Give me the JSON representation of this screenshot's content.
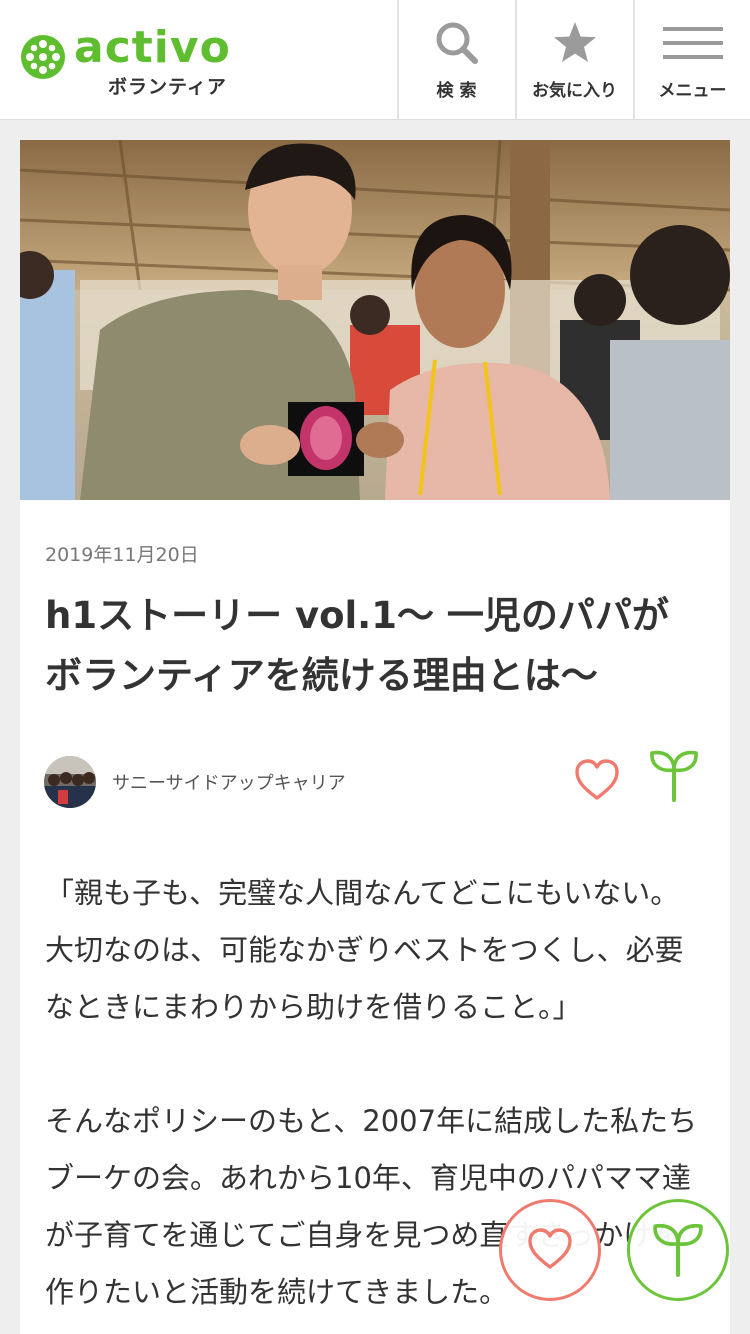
{
  "header": {
    "logo_text": "activo",
    "logo_subtitle": "ボランティア",
    "nav": {
      "search_label": "検 索",
      "favorites_label": "お気に入り",
      "menu_label": "メニュー"
    }
  },
  "article": {
    "date": "2019年11月20日",
    "title": "h1ストーリー vol.1〜 一児のパパがボランティアを続ける理由とは〜",
    "author": "サニーサイドアップキャリア",
    "paragraphs": [
      "「親も子も、完璧な人間なんてどこにもいない。大切なのは、可能なかぎりベストをつくし、必要なときにまわりから助けを借りること。」",
      "そんなポリシーのもと、2007年に結成した私たちブーケの会。あれから10年、育児中のパパママ達が子育てを通じてご自身を見つめ直すきっかけを作りたいと活動を続けてきました。"
    ]
  },
  "icons": {
    "logo": "activo-logo-icon",
    "search": "search-icon",
    "favorites": "star-icon",
    "menu": "hamburger-icon",
    "like": "heart-icon",
    "support": "sprout-icon"
  },
  "colors": {
    "brand_green": "#5fbe2f",
    "like_red": "#ef7a6d",
    "sprout_green": "#6cc43b"
  }
}
